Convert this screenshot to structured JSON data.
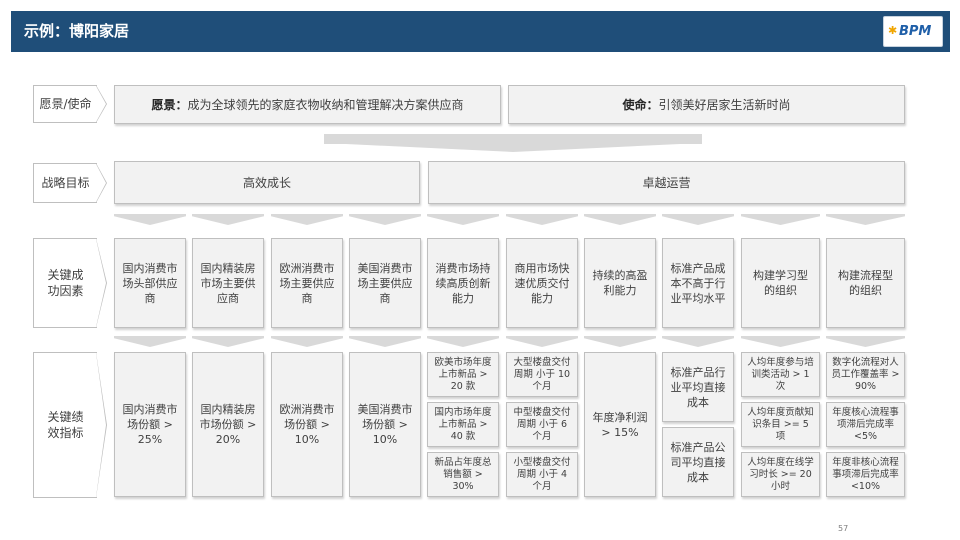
{
  "header": {
    "title": "示例：博阳家居",
    "logo_text": "BPM",
    "logo_mark": "✱"
  },
  "labels": {
    "vision": "愿景/使命",
    "goals": "战略目标",
    "csf": "关键成功因素",
    "kpi": "关键绩效指标"
  },
  "vision": {
    "prefix": "愿景：",
    "text": "成为全球领先的家庭衣物收纳和管理解决方案供应商"
  },
  "mission": {
    "prefix": "使命：",
    "text": "引领美好居家生活新时尚"
  },
  "goals": {
    "growth": "高效成长",
    "ops": "卓越运营"
  },
  "csf": [
    "国内消费市场头部供应商",
    "国内精装房市场主要供应商",
    "欧洲消费市场主要供应商",
    "美国消费市场主要供应商",
    "消费市场持续高质创新能力",
    "商用市场快速优质交付能力",
    "持续的高盈利能力",
    "标准产品成本不高于行业平均水平",
    "构建学习型的组织",
    "构建流程型的组织"
  ],
  "kpi": {
    "c1": "国内消费市场份额 > 25%",
    "c2": "国内精装房市场份额 > 20%",
    "c3": "欧洲消费市场份额 > 10%",
    "c4": "美国消费市场份额 > 10%",
    "c5": [
      "欧美市场年度上市新品 > 20 款",
      "国内市场年度上市新品 > 40 款",
      "新品占年度总销售额 > 30%"
    ],
    "c6": [
      "大型楼盘交付周期 小于 10 个月",
      "中型楼盘交付周期 小于 6 个月",
      "小型楼盘交付周期 小于 4 个月"
    ],
    "c7": "年度净利润 > 15%",
    "c8": [
      "标准产品行业平均直接成本",
      "标准产品公司平均直接成本"
    ],
    "c9": [
      "人均年度参与培训类活动 > 1 次",
      "人均年度贡献知识条目 >= 5 项",
      "人均年度在线学习时长 >= 20 小时"
    ],
    "c10": [
      "数字化流程对人员工作覆盖率 > 90%",
      "年度核心流程事项滞后完成率 <5%",
      "年度非核心流程事项滞后完成率 <10%"
    ]
  },
  "page_number": "57",
  "colors": {
    "header_bg": "#1f4e79",
    "box_fill": "#f2f2f2",
    "box_border": "#bfbfbf",
    "connector": "#d9d9d9"
  }
}
